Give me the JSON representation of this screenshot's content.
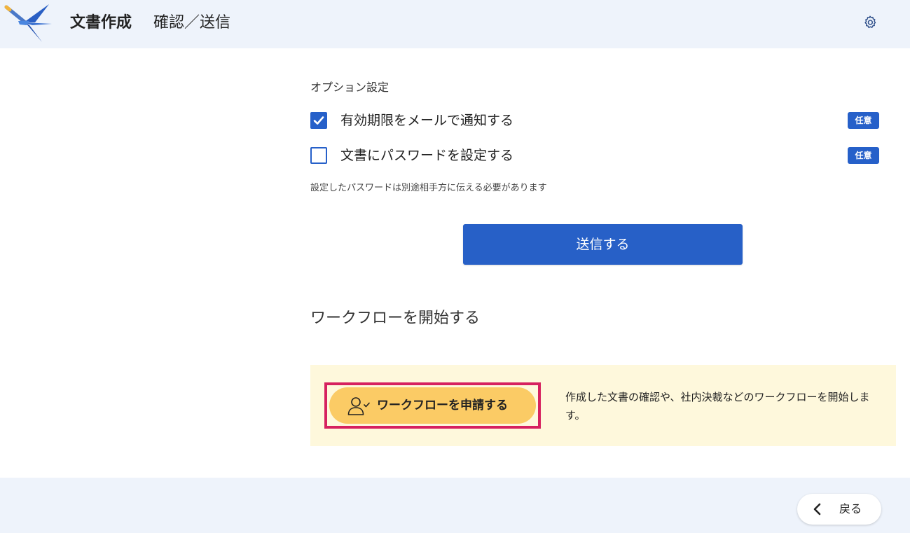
{
  "header": {
    "app_title": "文書作成",
    "page_title": "確認／送信",
    "logo_icon": "swallow-logo-icon",
    "settings_icon": "gear-icon"
  },
  "options": {
    "section_label": "オプション設定",
    "items": [
      {
        "label": "有効期限をメールで通知する",
        "checked": true,
        "badge": "任意"
      },
      {
        "label": "文書にパスワードを設定する",
        "checked": false,
        "badge": "任意"
      }
    ],
    "note": "設定したパスワードは別途相手方に伝える必要があります"
  },
  "send": {
    "label": "送信する"
  },
  "workflow": {
    "heading": "ワークフローを開始する",
    "button_label": "ワークフローを申請する",
    "button_icon": "user-check-icon",
    "description": "作成した文書の確認や、社内決裁などのワークフローを開始します。"
  },
  "footer": {
    "back_label": "戻る",
    "back_icon": "chevron-left-icon"
  },
  "colors": {
    "primary": "#2660c9",
    "header_bg": "#eef3fb",
    "workflow_panel_bg": "#fef8dc",
    "workflow_button_bg": "#fbcb65",
    "highlight_border": "#d6215f"
  }
}
